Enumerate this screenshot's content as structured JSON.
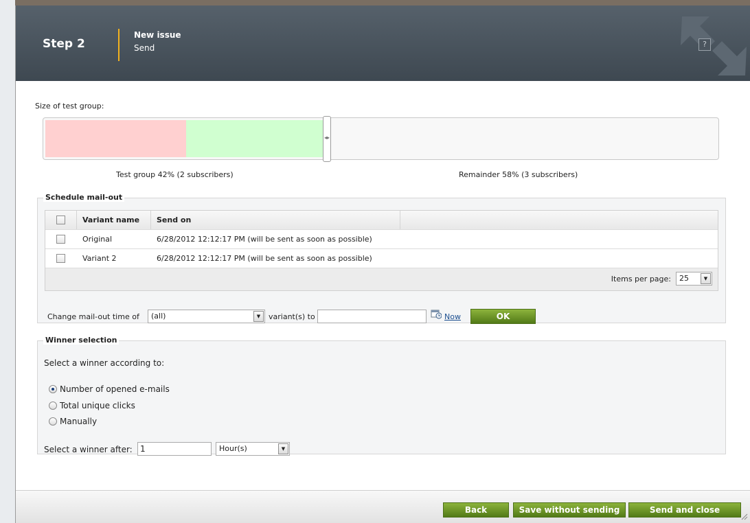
{
  "header": {
    "step": "Step 2",
    "title": "New issue",
    "subtitle": "Send",
    "help": "?"
  },
  "test_group": {
    "label": "Size of test group:",
    "test_percent": 42,
    "test_label": "Test group 42% (2 subscribers)",
    "remainder_label": "Remainder 58% (3 subscribers)"
  },
  "schedule": {
    "legend": "Schedule mail-out",
    "columns": [
      "Variant name",
      "Send on"
    ],
    "rows": [
      {
        "name": "Original",
        "send_on": "6/28/2012 12:12:17 PM (will be sent as soon as possible)"
      },
      {
        "name": "Variant 2",
        "send_on": "6/28/2012 12:12:17 PM (will be sent as soon as possible)"
      }
    ],
    "items_per_page_label": "Items per page:",
    "items_per_page_value": "25",
    "change_label": "Change mail-out time of",
    "variant_select_value": "(all)",
    "variants_to_label": "variant(s) to",
    "time_input_value": "",
    "now_link": "Now",
    "ok_button": "OK"
  },
  "winner": {
    "legend": "Winner selection",
    "criteria_label": "Select a winner according to:",
    "options": [
      {
        "label": "Number of opened e-mails",
        "checked": true
      },
      {
        "label": "Total unique clicks",
        "checked": false
      },
      {
        "label": "Manually",
        "checked": false
      }
    ],
    "after_label": "Select a winner after:",
    "after_value": "1",
    "unit_value": "Hour(s)"
  },
  "footer": {
    "back": "Back",
    "save": "Save without sending",
    "send": "Send and close"
  },
  "colors": {
    "header_bg": "#4a545e",
    "accent": "#f2b21f",
    "button_green": "#6a9227",
    "test_segment": "#ffd0d0",
    "selected_segment": "#d0ffd0"
  }
}
